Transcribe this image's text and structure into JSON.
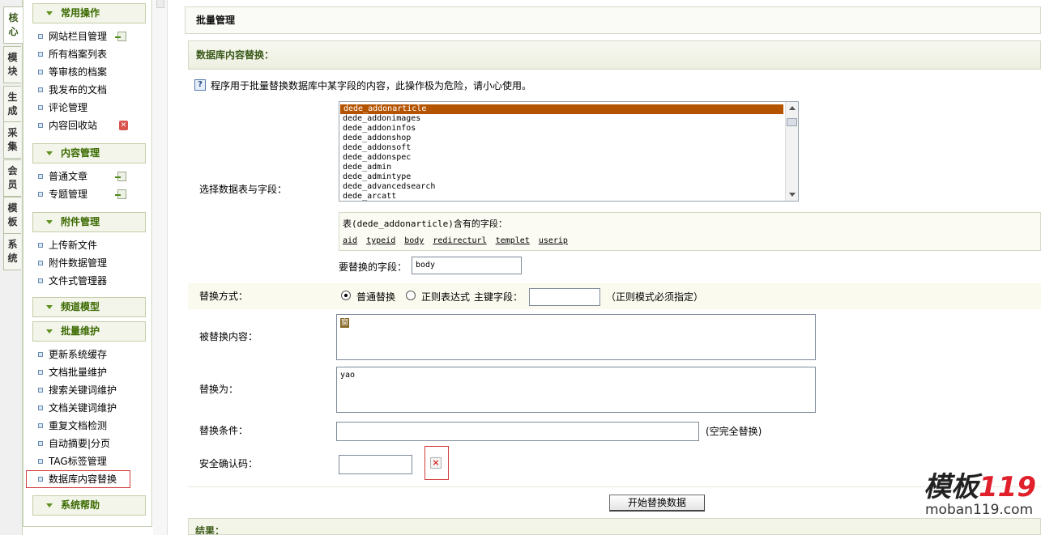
{
  "vertical_tabs": [
    {
      "label": "核心",
      "active": true
    },
    {
      "label": "模块",
      "active": false
    },
    {
      "label": "生成",
      "active": false
    },
    {
      "label": "采集",
      "active": false
    },
    {
      "label": "会员",
      "active": false
    },
    {
      "label": "模板",
      "active": false
    },
    {
      "label": "系统",
      "active": false
    }
  ],
  "menu": {
    "groups": [
      {
        "title": "常用操作",
        "items": [
          "网站栏目管理",
          "所有档案列表",
          "等审核的档案",
          "我发布的文档",
          "评论管理",
          "内容回收站"
        ]
      },
      {
        "title": "内容管理",
        "items": [
          "普通文章",
          "专题管理"
        ]
      },
      {
        "title": "附件管理",
        "items": [
          "上传新文件",
          "附件数据管理",
          "文件式管理器"
        ]
      },
      {
        "title": "频道模型",
        "items": []
      },
      {
        "title": "批量维护",
        "items": [
          "更新系统缓存",
          "文档批量维护",
          "搜索关键词维护",
          "文档关键词维护",
          "重复文档检测",
          "自动摘要|分页",
          "TAG标签管理",
          "数据库内容替换"
        ]
      },
      {
        "title": "系统帮助",
        "items": []
      }
    ]
  },
  "main": {
    "page_title": "批量管理",
    "section_title": "数据库内容替换：",
    "info": "程序用于批量替换数据库中某字段的内容，此操作极为危险，请小心使用。",
    "table_label": "选择数据表与字段：",
    "tables": [
      "dede_addonarticle",
      "dede_addonimages",
      "dede_addoninfos",
      "dede_addonshop",
      "dede_addonsoft",
      "dede_addonspec",
      "dede_admin",
      "dede_admintype",
      "dede_advancedsearch",
      "dede_arcatt"
    ],
    "fields_title": "表(dede_addonarticle)含有的字段：",
    "fields": [
      "aid",
      "typeid",
      "body",
      "redirecturl",
      "templet",
      "userip"
    ],
    "replace_field_label": "要替换的字段：",
    "replace_field_value": "body",
    "method_label": "替换方式：",
    "method_normal": "普通替换",
    "method_regex": "正则表达式",
    "primary_key_label": "主键字段：",
    "primary_key_value": "",
    "regex_note": "（正则模式必须指定）",
    "find_label": "被替换内容：",
    "find_value": "窗",
    "replace_label": "替换为：",
    "replace_value": "yao",
    "condition_label": "替换条件：",
    "condition_value": "",
    "condition_note": "(空完全替换)",
    "code_label": "安全确认码：",
    "code_value": "",
    "submit_label": "开始替换数据",
    "result_label": "结果："
  },
  "watermark": {
    "brand": "模板",
    "number": "119",
    "url": "moban119.com"
  },
  "colors": {
    "accent": "#3b6a00",
    "selected": "#b55400",
    "highlight_border": "#d23c3c"
  }
}
